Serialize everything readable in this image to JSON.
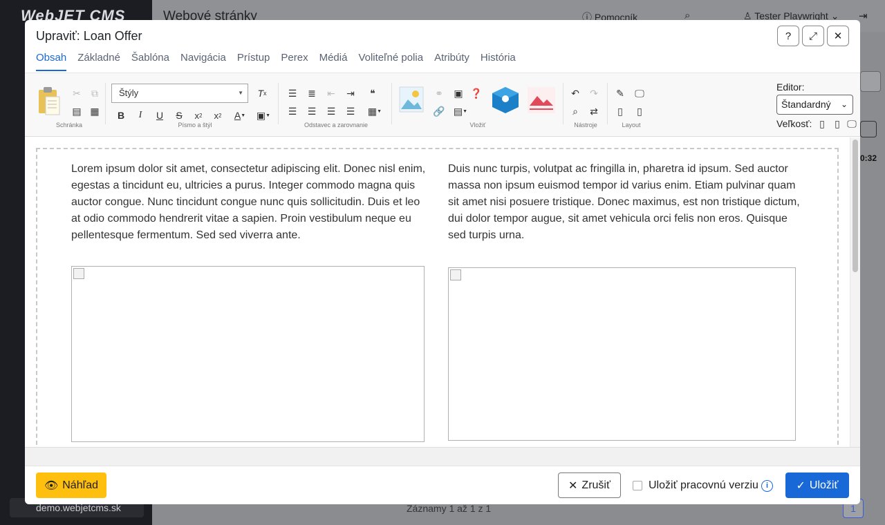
{
  "background": {
    "logo": "WebJET CMS",
    "page_title": "Webové stránky",
    "help_label": "Pomocník",
    "user_name": "Tester Playwright",
    "domain": "demo.webjetcms.sk",
    "records": "Záznamy 1 až 1 z 1",
    "page_number": "1",
    "time_fragment": "0:32"
  },
  "modal": {
    "title": "Upraviť: Loan Offer",
    "tabs": [
      "Obsah",
      "Základné",
      "Šablóna",
      "Navigácia",
      "Prístup",
      "Perex",
      "Médiá",
      "Voliteľné polia",
      "Atribúty",
      "História"
    ],
    "active_tab": "Obsah"
  },
  "toolbar": {
    "groups": [
      "Schránka",
      "Písmo a štýl",
      "Odstavec a zarovnanie",
      "Vložiť",
      "Nástroje",
      "Layout"
    ],
    "styles_placeholder": "Štýly",
    "editor_label": "Editor:",
    "editor_value": "Štandardný",
    "size_label": "Veľkosť:"
  },
  "content": {
    "left_text": "Lorem ipsum dolor sit amet, consectetur adipiscing elit. Donec nisl enim, egestas a tincidunt eu, ultricies a purus. Integer commodo magna quis auctor congue. Nunc tincidunt congue nunc quis sollicitudin. Duis et leo at odio commodo hendrerit vitae a sapien. Proin vestibulum neque eu pellentesque fermentum. Sed sed viverra ante.",
    "right_text": "Duis nunc turpis, volutpat ac fringilla in, pharetra id ipsum. Sed auctor massa non ipsum euismod tempor id varius enim. Etiam pulvinar quam sit amet nisi posuere tristique. Donec maximus, est non tristique dictum, dui dolor tempor augue, sit amet vehicula orci felis non eros. Quisque sed turpis urna."
  },
  "footer": {
    "preview_label": "Náhľad",
    "cancel_label": "Zrušiť",
    "save_work_label": "Uložiť pracovnú verziu",
    "save_label": "Uložiť"
  },
  "colors": {
    "accent": "#1868d8",
    "preview_button": "#ffbf0f"
  }
}
